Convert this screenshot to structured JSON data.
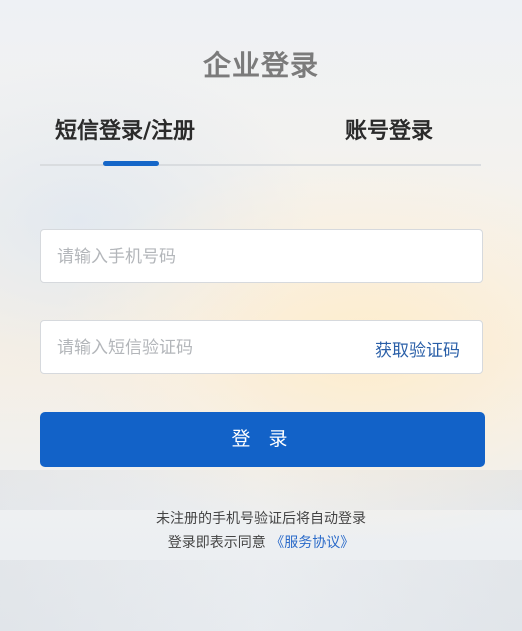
{
  "page": {
    "title": "企业登录"
  },
  "tabs": [
    {
      "label": "短信登录/注册",
      "active": true
    },
    {
      "label": "账号登录",
      "active": false
    }
  ],
  "form": {
    "phone_placeholder": "请输入手机号码",
    "code_placeholder": "请输入短信验证码",
    "get_code_label": "获取验证码",
    "login_label": "登 录"
  },
  "notes": {
    "line1": "未注册的手机号验证后将自动登录",
    "line2_prefix": "登录即表示同意 ",
    "agreement_link": "《服务协议》"
  },
  "colors": {
    "accent": "#1262c8",
    "link": "#2a6ac9"
  }
}
